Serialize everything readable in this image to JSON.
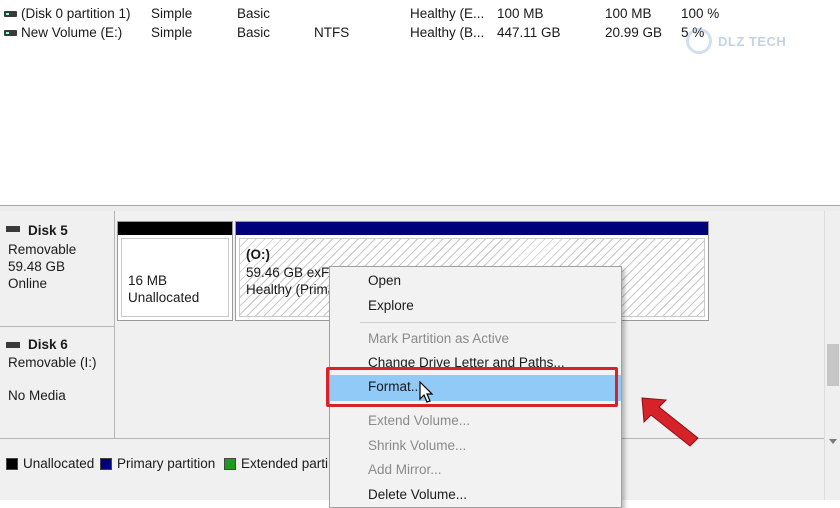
{
  "volumes": [
    {
      "name": "(Disk 0 partition 1)",
      "layout": "Simple",
      "type": "Basic",
      "fs": "",
      "status": "Healthy (E...",
      "capacity": "100 MB",
      "free": "100 MB",
      "pct_free": "100 %"
    },
    {
      "name": "New Volume (E:)",
      "layout": "Simple",
      "type": "Basic",
      "fs": "NTFS",
      "status": "Healthy (B...",
      "capacity": "447.11 GB",
      "free": "20.99 GB",
      "pct_free": "5 %"
    }
  ],
  "watermark": "DLZ TECH",
  "disks": {
    "disk5": {
      "name": "Disk 5",
      "type": "Removable",
      "size": "59.48 GB",
      "status": "Online",
      "partitions": [
        {
          "size": "16 MB",
          "label": "Unallocated"
        },
        {
          "label": "(O:)",
          "size": "59.46 GB exFAT",
          "status": "Healthy (Prima"
        }
      ]
    },
    "disk6": {
      "name": "Disk 6",
      "type": "Removable (I:)",
      "media": "No Media"
    }
  },
  "legend": [
    {
      "label": "Unallocated",
      "color": "#000000"
    },
    {
      "label": "Primary partition",
      "color": "#00007a"
    },
    {
      "label": "Extended parti",
      "color": "#1f9a1f"
    }
  ],
  "colors": {
    "unallocated_bar": "#000000",
    "primary_bar": "#00007a",
    "menu_highlight": "#91c9f7",
    "annotation_red": "#d6232a"
  },
  "context_menu": {
    "items": [
      {
        "label": "Open",
        "enabled": true
      },
      {
        "label": "Explore",
        "enabled": true
      },
      {
        "label": "Mark Partition as Active",
        "enabled": false
      },
      {
        "label": "Change Drive Letter and Paths...",
        "enabled": true
      },
      {
        "label": "Format...",
        "enabled": true,
        "highlighted": true
      },
      {
        "label": "Extend Volume...",
        "enabled": false
      },
      {
        "label": "Shrink Volume...",
        "enabled": false
      },
      {
        "label": "Add Mirror...",
        "enabled": false
      },
      {
        "label": "Delete Volume...",
        "enabled": true
      }
    ]
  }
}
